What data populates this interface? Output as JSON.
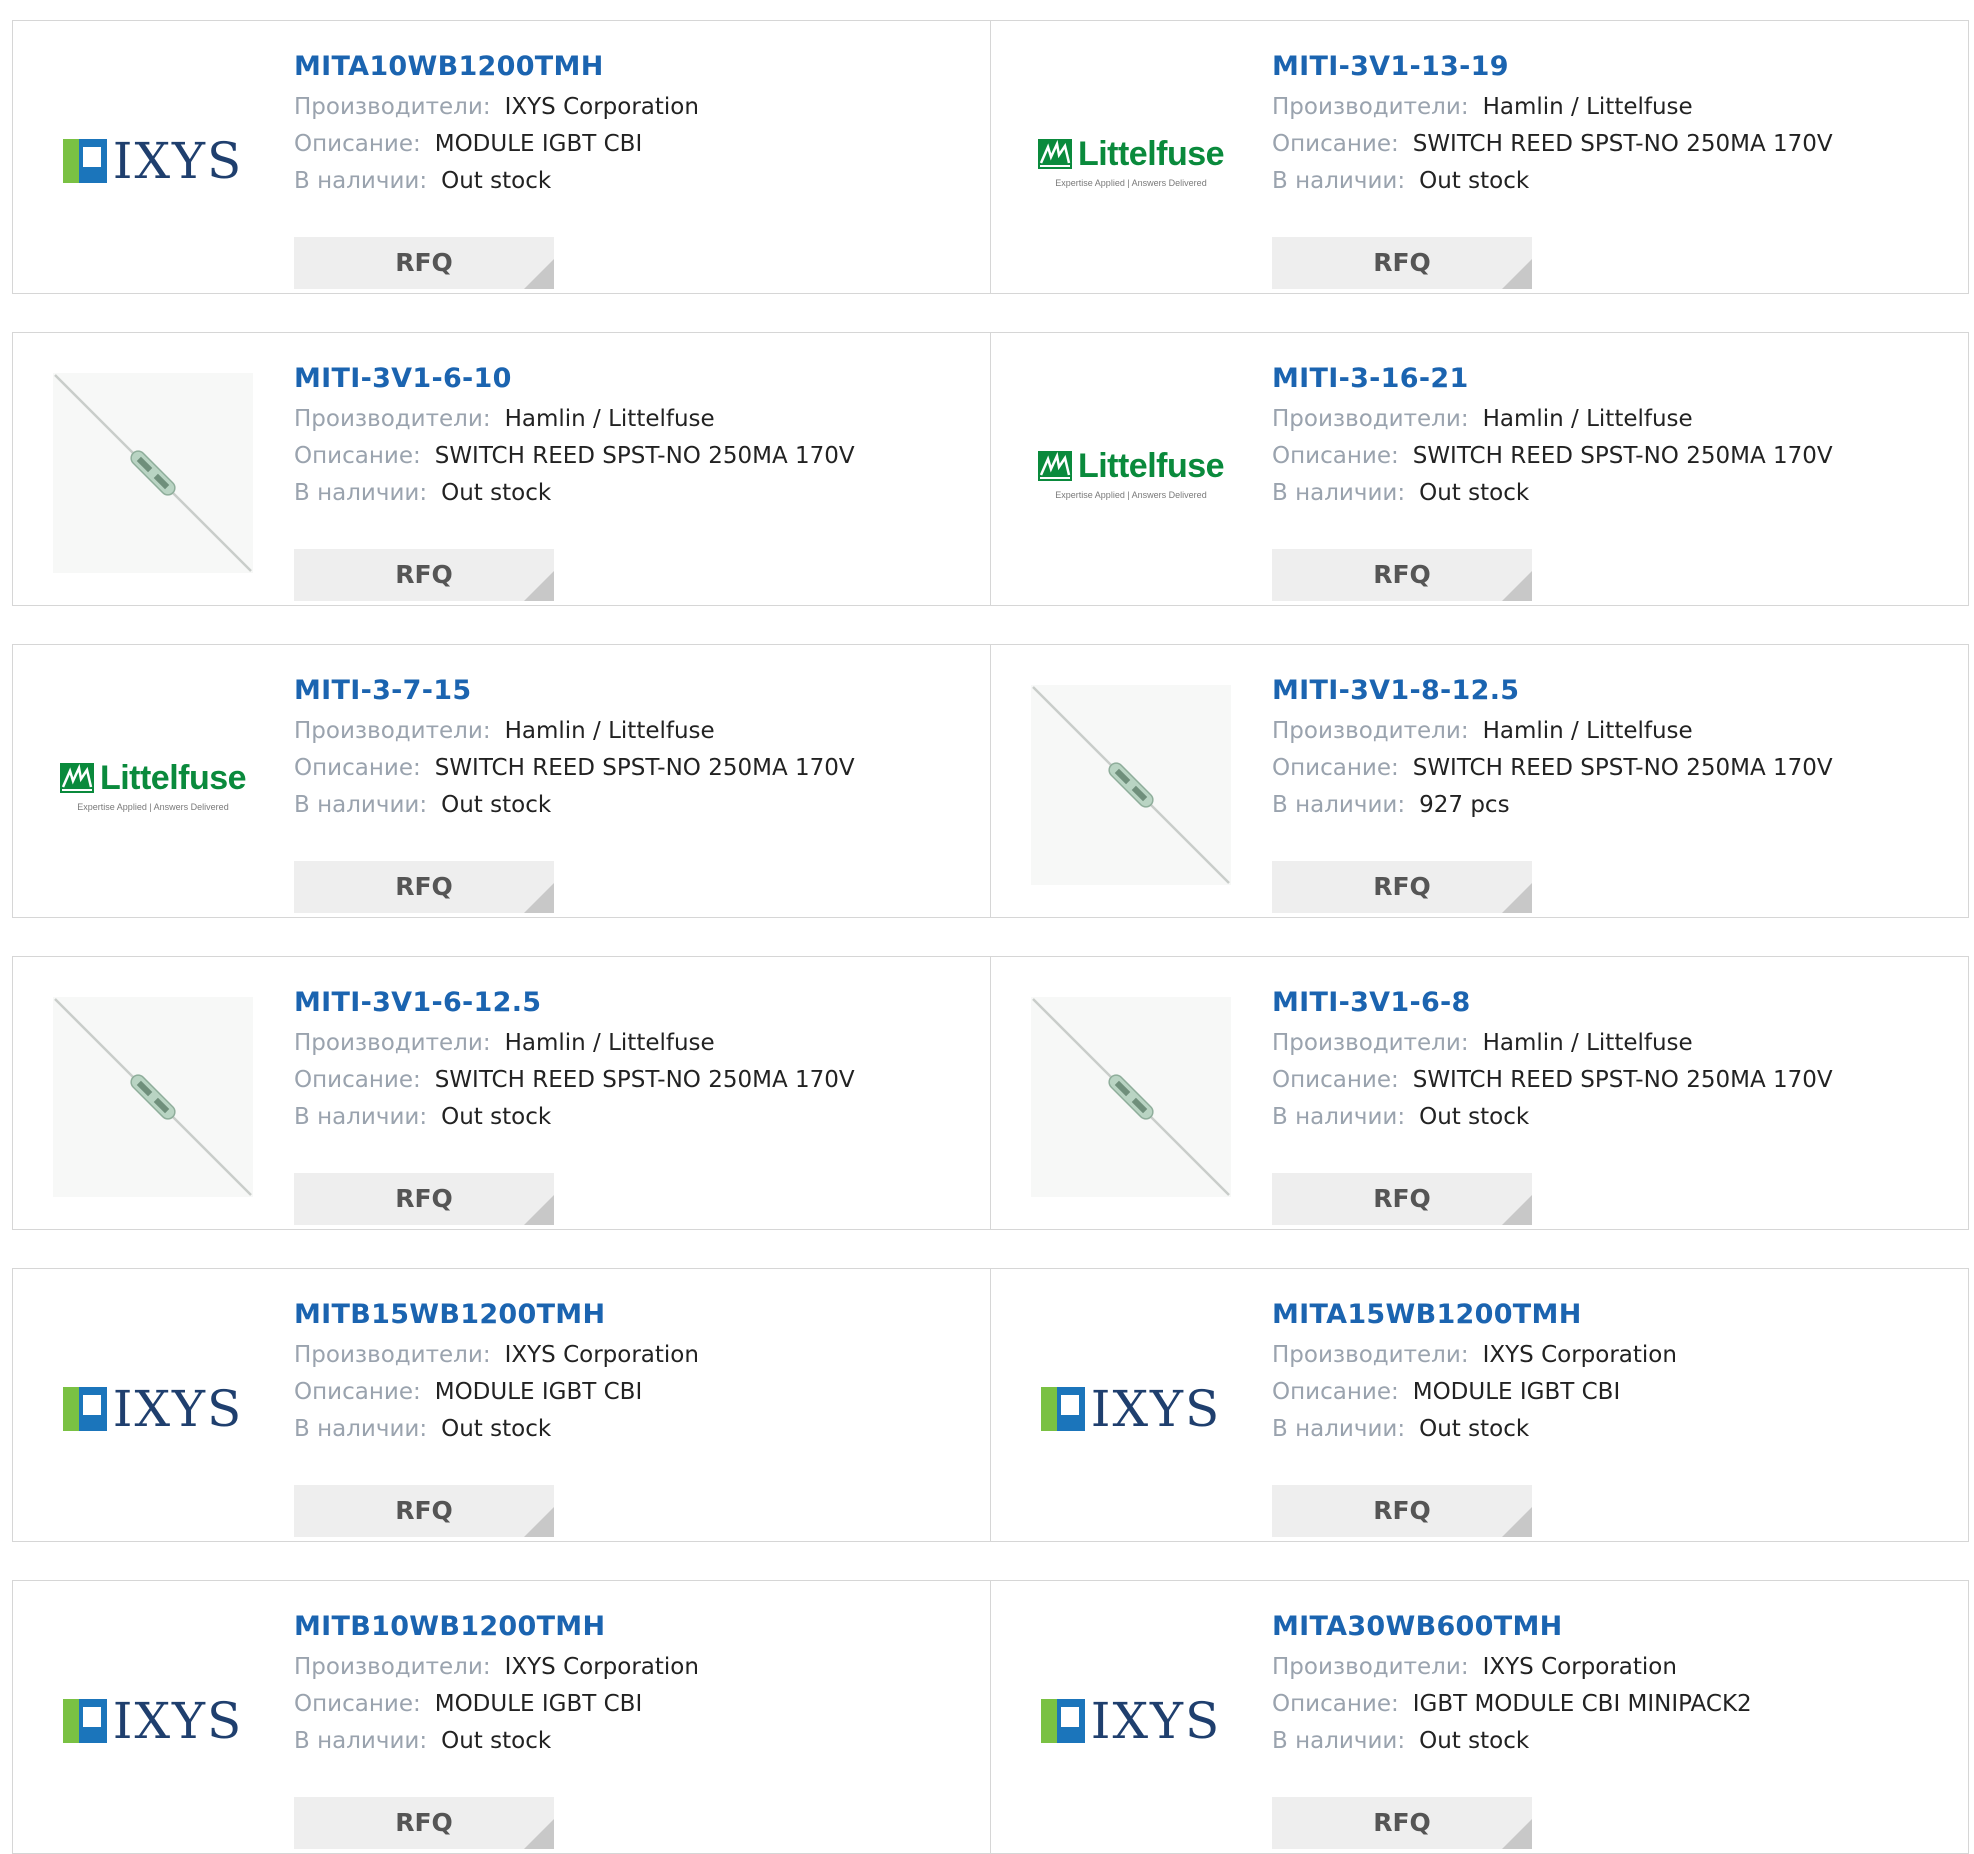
{
  "labels": {
    "manufacturer": "Производители:",
    "description": "Описание:",
    "stock": "В наличии:",
    "rfq": "RFQ"
  },
  "logos": {
    "ixys_text": "IXYS",
    "littelfuse_text": "Littelfuse",
    "littelfuse_tagline": "Expertise Applied | Answers Delivered"
  },
  "colors": {
    "link": "#1b64b0",
    "label": "#9aa3ae",
    "button_bg": "#eeeeee"
  },
  "products": [
    {
      "pn": "MITA10WB1200TMH",
      "manufacturer": "IXYS Corporation",
      "description": "MODULE IGBT CBI",
      "stock": "Out stock",
      "image": "ixys-logo"
    },
    {
      "pn": "MITI-3V1-13-19",
      "manufacturer": "Hamlin / Littelfuse",
      "description": "SWITCH REED SPST-NO 250MA 170V",
      "stock": "Out stock",
      "image": "littelfuse-logo"
    },
    {
      "pn": "MITI-3V1-6-10",
      "manufacturer": "Hamlin / Littelfuse",
      "description": "SWITCH REED SPST-NO 250MA 170V",
      "stock": "Out stock",
      "image": "reed-switch-photo"
    },
    {
      "pn": "MITI-3-16-21",
      "manufacturer": "Hamlin / Littelfuse",
      "description": "SWITCH REED SPST-NO 250MA 170V",
      "stock": "Out stock",
      "image": "littelfuse-logo"
    },
    {
      "pn": "MITI-3-7-15",
      "manufacturer": "Hamlin / Littelfuse",
      "description": "SWITCH REED SPST-NO 250MA 170V",
      "stock": "Out stock",
      "image": "littelfuse-logo"
    },
    {
      "pn": "MITI-3V1-8-12.5",
      "manufacturer": "Hamlin / Littelfuse",
      "description": "SWITCH REED SPST-NO 250MA 170V",
      "stock": "927 pcs",
      "image": "reed-switch-photo"
    },
    {
      "pn": "MITI-3V1-6-12.5",
      "manufacturer": "Hamlin / Littelfuse",
      "description": "SWITCH REED SPST-NO 250MA 170V",
      "stock": "Out stock",
      "image": "reed-switch-photo"
    },
    {
      "pn": "MITI-3V1-6-8",
      "manufacturer": "Hamlin / Littelfuse",
      "description": "SWITCH REED SPST-NO 250MA 170V",
      "stock": "Out stock",
      "image": "reed-switch-photo"
    },
    {
      "pn": "MITB15WB1200TMH",
      "manufacturer": "IXYS Corporation",
      "description": "MODULE IGBT CBI",
      "stock": "Out stock",
      "image": "ixys-logo"
    },
    {
      "pn": "MITA15WB1200TMH",
      "manufacturer": "IXYS Corporation",
      "description": "MODULE IGBT CBI",
      "stock": "Out stock",
      "image": "ixys-logo"
    },
    {
      "pn": "MITB10WB1200TMH",
      "manufacturer": "IXYS Corporation",
      "description": "MODULE IGBT CBI",
      "stock": "Out stock",
      "image": "ixys-logo"
    },
    {
      "pn": "MITA30WB600TMH",
      "manufacturer": "IXYS Corporation",
      "description": "IGBT MODULE CBI MINIPACK2",
      "stock": "Out stock",
      "image": "ixys-logo"
    }
  ]
}
